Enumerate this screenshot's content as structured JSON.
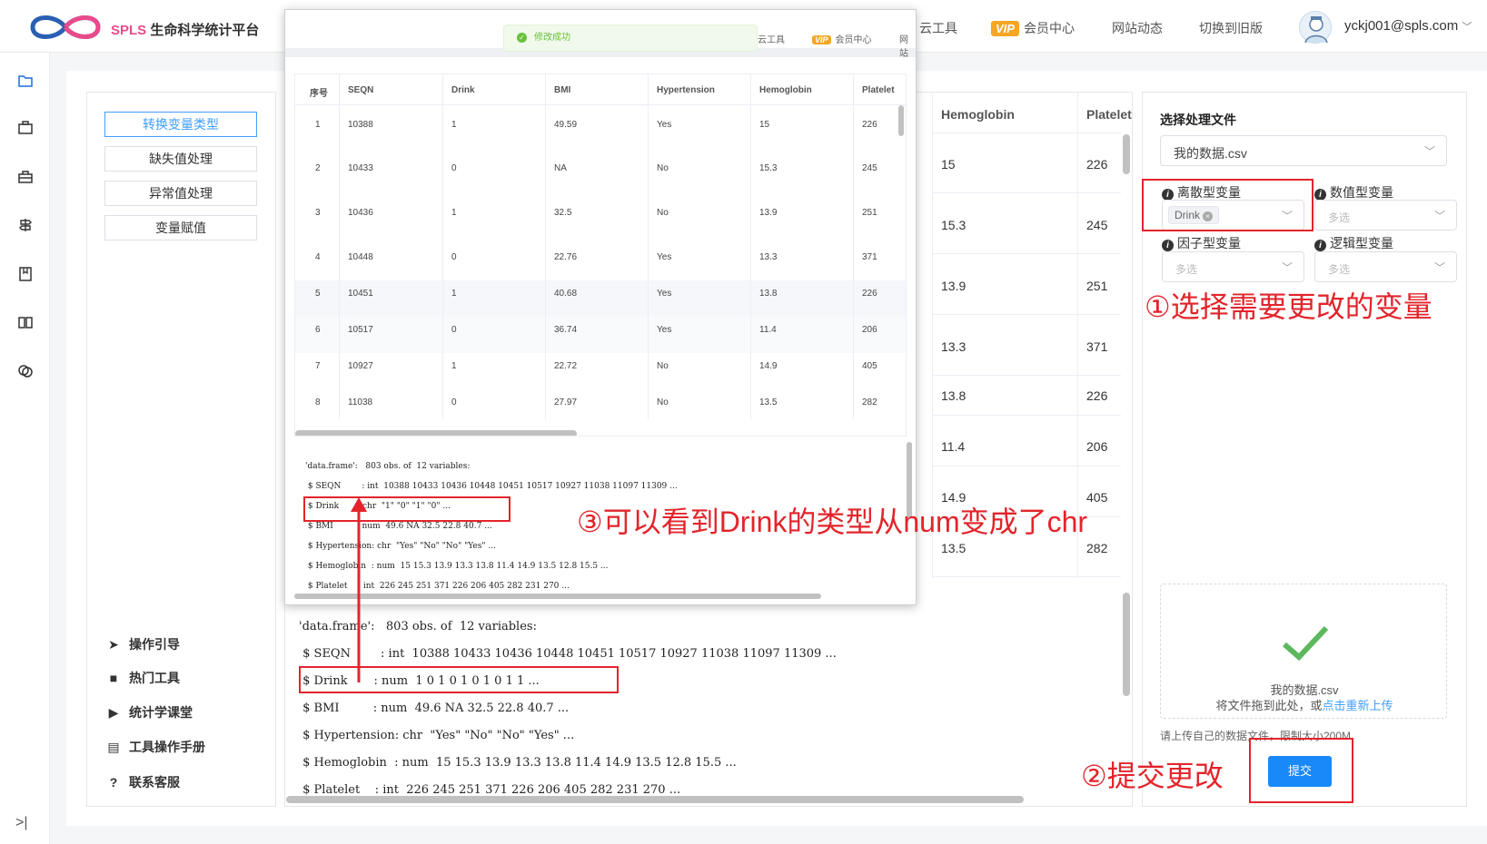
{
  "header": {
    "logo_en": "SPLS",
    "logo_cn": "生命科学统计平台",
    "nav": [
      {
        "label": "云工具"
      },
      {
        "label": "会员中心",
        "vip": "VIP"
      },
      {
        "label": "网站动态"
      },
      {
        "label": "切换到旧版"
      }
    ],
    "user": "yckj001@spls.com"
  },
  "iconbar": {
    "icons": [
      "folder-icon",
      "briefcase-icon",
      "toolbox-icon",
      "signpost-icon",
      "bookmark-book-icon",
      "open-book-icon",
      "chat-icon"
    ],
    "collapse": ">|"
  },
  "menu": {
    "buttons": [
      "转换变量类型",
      "缺失值处理",
      "异常值处理",
      "变量赋值"
    ],
    "links": [
      "操作引导",
      "热门工具",
      "统计学课堂",
      "工具操作手册",
      "联系客服"
    ]
  },
  "bg_table": {
    "headers": [
      "Hemoglobin",
      "Platelet"
    ],
    "hemoglobin": [
      "15",
      "15.3",
      "13.9",
      "13.3",
      "13.8",
      "11.4",
      "14.9",
      "13.5"
    ],
    "platelet": [
      "226",
      "245",
      "251",
      "371",
      "226",
      "206",
      "405",
      "282"
    ]
  },
  "bg_str": [
    "'data.frame':   803 obs. of  12 variables:",
    " $ SEQN        : int  10388 10433 10436 10448 10451 10517 10927 11038 11097 11309 ...",
    " $ Drink       : num  1 0 1 0 1 0 1 0 1 1 ...",
    " $ BMI         : num  49.6 NA 32.5 22.8 40.7 ...",
    " $ Hypertension: chr  \"Yes\" \"No\" \"No\" \"Yes\" ...",
    " $ Hemoglobin  : num  15 15.3 13.9 13.3 13.8 11.4 14.9 13.5 12.8 15.5 ...",
    " $ Platelet    : int  226 245 251 371 226 206 405 282 231 270 ..."
  ],
  "right_panel": {
    "title": "选择处理文件",
    "file_select": "我的数据.csv",
    "discrete_label": "离散型变量",
    "discrete_tag": "Drink",
    "numeric_label": "数值型变量",
    "factor_label": "因子型变量",
    "logical_label": "逻辑型变量",
    "placeholder": "多选",
    "upload_file": "我的数据.csv",
    "upload_hint": "将文件拖到此处，或",
    "upload_link": "点击重新上传",
    "upload_note": "请上传自己的数据文件，限制大小200M",
    "submit": "提交"
  },
  "annotations": {
    "step1": "①选择需要更改的变量",
    "step2": "②提交更改",
    "step3": "③可以看到Drink的类型从num变成了chr"
  },
  "popup": {
    "toast": "修改成功",
    "nav": [
      {
        "label": "云工具"
      },
      {
        "label": "会员中心",
        "vip": "VIP"
      },
      {
        "label": "网站"
      }
    ],
    "headers": [
      "序号",
      "SEQN",
      "Drink",
      "BMI",
      "Hypertension",
      "Hemoglobin",
      "Platelet"
    ],
    "rows": [
      [
        "1",
        "10388",
        "1",
        "49.59",
        "Yes",
        "15",
        "226"
      ],
      [
        "2",
        "10433",
        "0",
        "NA",
        "No",
        "15.3",
        "245"
      ],
      [
        "3",
        "10436",
        "1",
        "32.5",
        "No",
        "13.9",
        "251"
      ],
      [
        "4",
        "10448",
        "0",
        "22.76",
        "Yes",
        "13.3",
        "371"
      ],
      [
        "5",
        "10451",
        "1",
        "40.68",
        "Yes",
        "13.8",
        "226"
      ],
      [
        "6",
        "10517",
        "0",
        "36.74",
        "Yes",
        "11.4",
        "206"
      ],
      [
        "7",
        "10927",
        "1",
        "22.72",
        "No",
        "14.9",
        "405"
      ],
      [
        "8",
        "11038",
        "0",
        "27.97",
        "No",
        "13.5",
        "282"
      ]
    ],
    "str": [
      "'data.frame':   803 obs. of  12 variables:",
      " $ SEQN        : int  10388 10433 10436 10448 10451 10517 10927 11038 11097 11309 ...",
      " $ Drink       : chr  \"1\" \"0\" \"1\" \"0\" ...",
      " $ BMI         : num  49.6 NA 32.5 22.8 40.7 ...",
      " $ Hypertension: chr  \"Yes\" \"No\" \"No\" \"Yes\" ...",
      " $ Hemoglobin  : num  15 15.3 13.9 13.3 13.8 11.4 14.9 13.5 12.8 15.5 ...",
      " $ Platelet    : int  226 245 251 371 226 206 405 282 231 270 ..."
    ]
  },
  "colors": {
    "accent": "#409eff",
    "annotation": "#e3242b",
    "success": "#67c23a",
    "vip": "#f5a623"
  }
}
